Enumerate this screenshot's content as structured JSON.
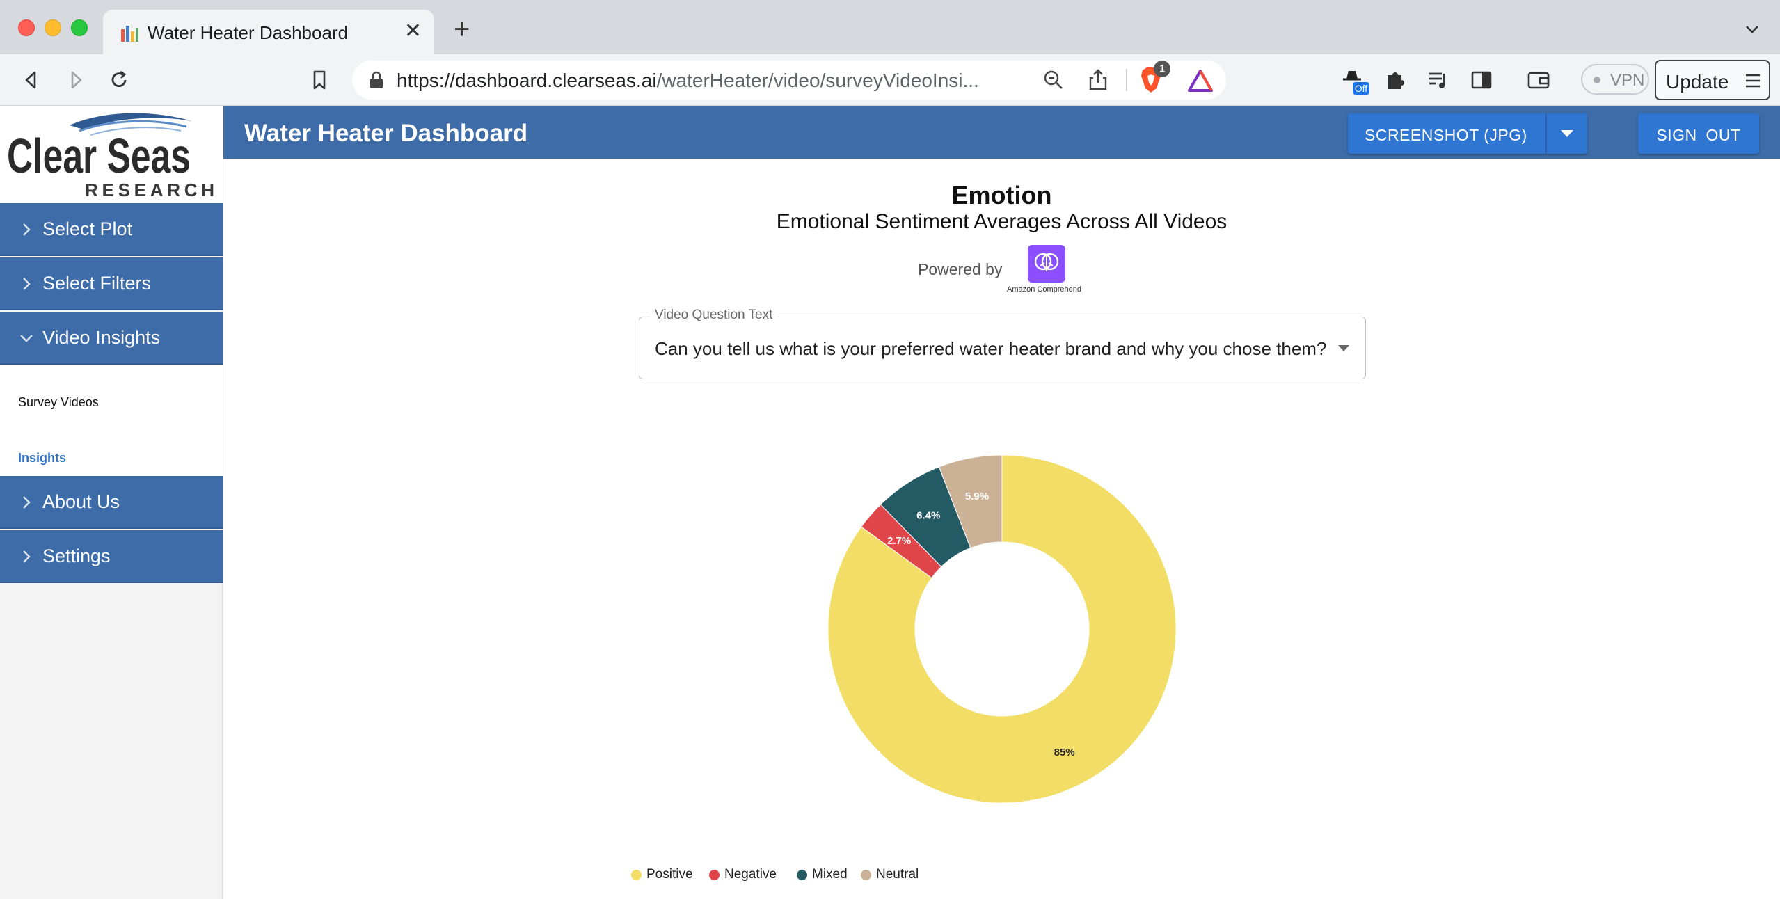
{
  "browser": {
    "tab_title": "Water Heater Dashboard",
    "url_host": "https://dashboard.clearseas.ai",
    "url_path": "/waterHeater/video/surveyVideoInsi...",
    "extension_badge": "Off",
    "shield_count": "1",
    "vpn_label": "VPN",
    "update_label": "Update"
  },
  "logo": {
    "line1": "Clear Seas",
    "line2": "RESEARCH"
  },
  "sidebar": {
    "items": [
      {
        "label": "Select Plot",
        "expanded": false
      },
      {
        "label": "Select Filters",
        "expanded": false
      },
      {
        "label": "Video Insights",
        "expanded": true
      },
      {
        "label": "About Us",
        "expanded": false
      },
      {
        "label": "Settings",
        "expanded": false
      }
    ],
    "submenu": [
      {
        "label": "Survey Videos",
        "active": false
      },
      {
        "label": "Insights",
        "active": true
      }
    ]
  },
  "header": {
    "title": "Water Heater Dashboard",
    "screenshot_label": "SCREENSHOT (JPG)",
    "signout_label": "SIGN OUT"
  },
  "main": {
    "powered_by": "Powered by",
    "provider_label": "Amazon Comprehend",
    "question_select": {
      "label": "Video Question Text",
      "value": "Can you tell us what is your preferred water heater brand and why you chose them?"
    }
  },
  "chart_data": {
    "type": "pie",
    "title": "Emotion",
    "subtitle": "Emotional Sentiment Averages Across All Videos",
    "donut": true,
    "legend_position": "bottom",
    "series": [
      {
        "name": "Positive",
        "value": 85.0,
        "label": "85%",
        "color": "#f2dd66"
      },
      {
        "name": "Negative",
        "value": 2.7,
        "label": "2.7%",
        "color": "#e0454a"
      },
      {
        "name": "Mixed",
        "value": 6.4,
        "label": "6.4%",
        "color": "#235a63"
      },
      {
        "name": "Neutral",
        "value": 5.9,
        "label": "5.9%",
        "color": "#cbb196"
      }
    ]
  },
  "colors": {
    "brand_blue": "#3d6ca8",
    "button_blue": "#2f76d2"
  }
}
